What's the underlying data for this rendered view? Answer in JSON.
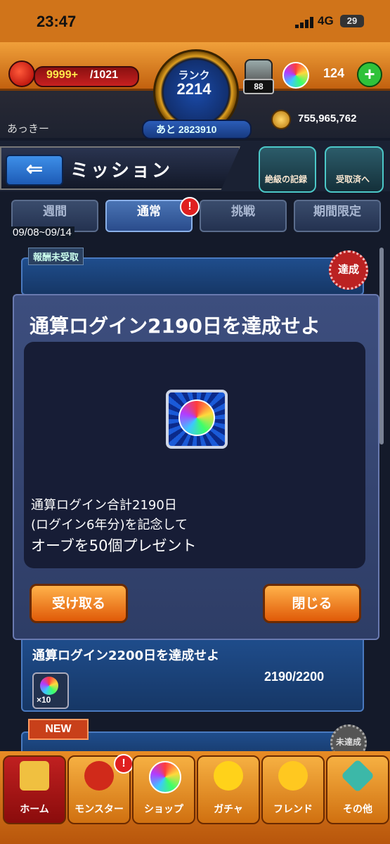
{
  "status_bar": {
    "time": "23:47",
    "network": "4G",
    "battery": "29"
  },
  "hud": {
    "stamina_current": "9999+",
    "stamina_max": "/1021",
    "rank_label": "ランク",
    "rank_value": "2214",
    "rank_next": "あと 2823910",
    "lucky_badge": "88",
    "orb_count": "124",
    "player_name": "あっきー",
    "gold": "755,965,762"
  },
  "page": {
    "title": "ミッション",
    "records_button": "絶級の記録",
    "received_button": "受取済へ"
  },
  "tabs": [
    "週間",
    "通常",
    "挑戦",
    "期間限定"
  ],
  "active_tab": "通常",
  "date_range": "09/08~09/14",
  "background": {
    "unclaimed_tag": "報酬未受取",
    "achieved_seal": "達成",
    "mission2_title": "通算ログイン2200日を達成せよ",
    "mission2_multiplier": "×10",
    "mission2_progress": "2190/2200",
    "new_tag": "NEW",
    "not_achieved_seal": "未達成"
  },
  "modal": {
    "title": "通算ログイン2190日を達成せよ",
    "desc_line1": "通算ログイン合計2190日",
    "desc_line2": "(ログイン6年分)を記念して",
    "desc_line3": "オーブを50個プレゼント",
    "receive_button": "受け取る",
    "close_button": "閉じる"
  },
  "bottom_nav": [
    "ホーム",
    "モンスター",
    "ショップ",
    "ガチャ",
    "フレンド",
    "その他"
  ],
  "colors": {
    "accent_orange": "#e88c25",
    "modal_blue": "#3d4e7e",
    "button_orange": "#f08a20"
  }
}
